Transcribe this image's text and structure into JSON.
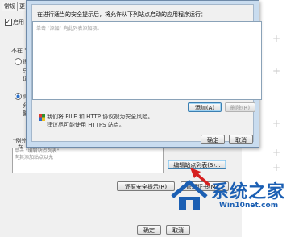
{
  "bg": {
    "tab_general": "常规",
    "tab_update": "更",
    "checkbox_label": "启用",
    "not_in_label": "不在 \"",
    "radio_1": "很",
    "radio_1_sub": "只",
    "radio_1_sub2": "证",
    "radio_2": "高",
    "radio_2_sub": "允",
    "radio_2_sub2": "警",
    "exception_label": "\"例外",
    "exception_sub": "在",
    "list_hint_1": "单击 \"编辑站点列表\"",
    "list_hint_2": "向其添加站点以允",
    "edit_site_list_button": "编辑站点列表(S)...",
    "restore_prompts_button": "还原安全提示(R)",
    "manage_cert_button": "管理证书(M)...",
    "ok_button": "确定",
    "cancel_button": "取消"
  },
  "dialog": {
    "description": "在进行适当的安全提示后，将允许从下列站点启动的应用程序运行：",
    "list_placeholder": "单击 \"添加\" 向此列表添加项。",
    "add_button": "添加(A)",
    "remove_button": "删除(R)",
    "warning_line_1": "FILE 和 HTTP 协议视为安全风险。",
    "warning_line_2": "建议尽可能使用 HTTPS 站点。",
    "ok_button": "确定",
    "cancel_button": "取消"
  },
  "watermark": {
    "name": "系统之家",
    "url": "Win10net.com"
  },
  "colors": {
    "dialog_frame": "#c9dcef",
    "arrow": "#d62020",
    "watermark_blue": "#1b5fb3"
  }
}
